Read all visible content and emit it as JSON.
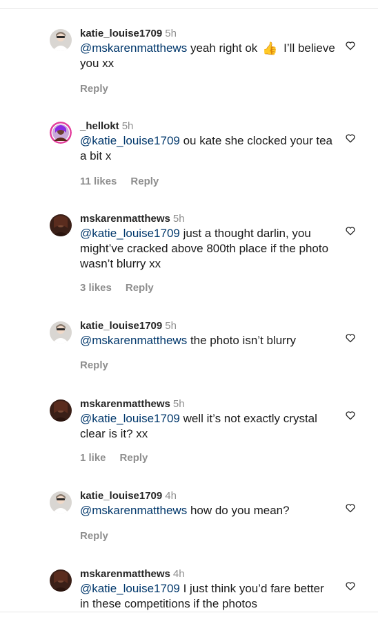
{
  "comments": [
    {
      "username": "katie_louise1709",
      "time": "5h",
      "mention": "@mskarenmatthews",
      "text_before_emoji": "yeah right ok",
      "emoji": "👍",
      "text_after_emoji": "I’ll believe you xx",
      "likes": "",
      "reply": "Reply",
      "avatar": "avatar-katie"
    },
    {
      "username": "_hellokt",
      "time": "5h",
      "mention": "@katie_louise1709",
      "text": "ou kate she clocked your tea a bit x",
      "likes": "11 likes",
      "reply": "Reply",
      "avatar": "avatar-hellokt"
    },
    {
      "username": "mskarenmatthews",
      "time": "5h",
      "mention": "@katie_louise1709",
      "text": "just a thought darlin, you might’ve cracked above 800th place if the photo wasn’t blurry xx",
      "likes": "3 likes",
      "reply": "Reply",
      "avatar": "avatar-karen"
    },
    {
      "username": "katie_louise1709",
      "time": "5h",
      "mention": "@mskarenmatthews",
      "text": "the photo isn’t blurry",
      "likes": "",
      "reply": "Reply",
      "avatar": "avatar-katie"
    },
    {
      "username": "mskarenmatthews",
      "time": "5h",
      "mention": "@katie_louise1709",
      "text": "well it’s not exactly crystal clear is it? xx",
      "likes": "1 like",
      "reply": "Reply",
      "avatar": "avatar-karen"
    },
    {
      "username": "katie_louise1709",
      "time": "4h",
      "mention": "@mskarenmatthews",
      "text": "how do you mean?",
      "likes": "",
      "reply": "Reply",
      "avatar": "avatar-katie"
    },
    {
      "username": "mskarenmatthews",
      "time": "4h",
      "mention": "@katie_louise1709",
      "text": "I just think you’d fare better in these competitions if the photos",
      "likes": "",
      "reply": "",
      "avatar": "avatar-karen"
    }
  ],
  "colors": {
    "mention": "#00376b",
    "secondary_text": "#8e8e8e",
    "primary_text": "#262626"
  },
  "icons": {
    "like": "heart-outline-icon"
  }
}
